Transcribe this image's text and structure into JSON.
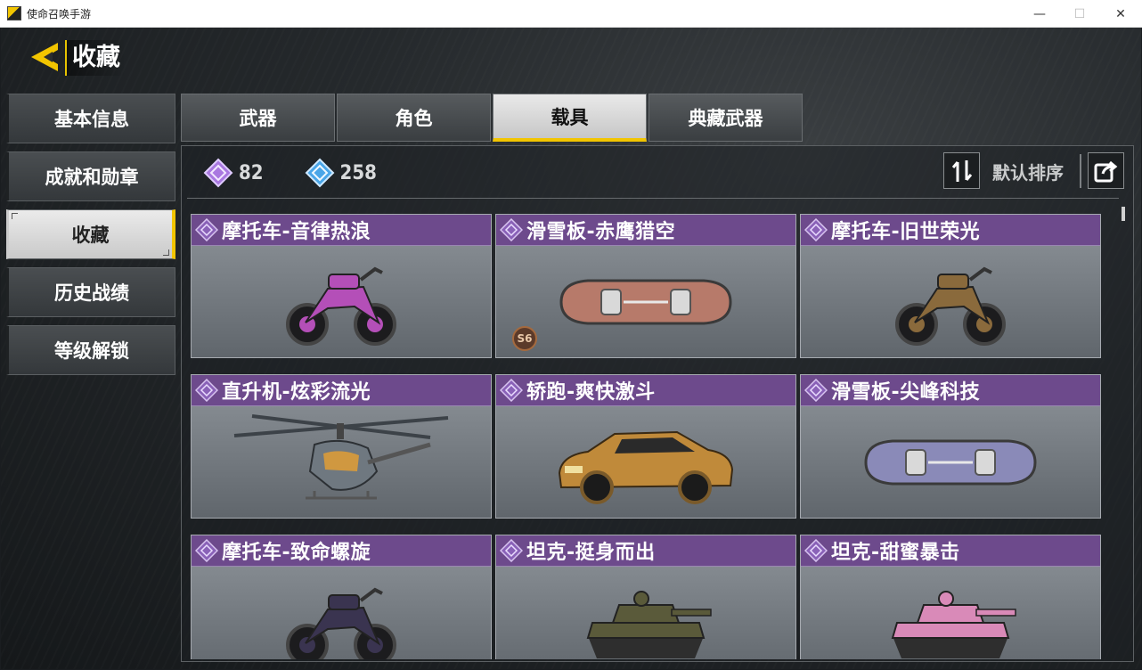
{
  "window": {
    "title": "使命召唤手游",
    "controls": {
      "minimize": "—",
      "maximize": "☐",
      "close": "✕"
    }
  },
  "header": {
    "title": "收藏",
    "back_icon": "back-arrow-icon",
    "accent_color": "#f2c500"
  },
  "side_menu": {
    "items": [
      {
        "label": "基本信息",
        "active": false
      },
      {
        "label": "成就和勋章",
        "active": false
      },
      {
        "label": "收藏",
        "active": true
      },
      {
        "label": "历史战绩",
        "active": false
      },
      {
        "label": "等级解锁",
        "active": false
      }
    ]
  },
  "tabs": [
    {
      "label": "武器",
      "active": false
    },
    {
      "label": "角色",
      "active": false
    },
    {
      "label": "载具",
      "active": true
    },
    {
      "label": "典藏武器",
      "active": false
    }
  ],
  "stats": {
    "epic_count": "82",
    "rare_count": "258",
    "epic_color": "#a978e0",
    "rare_color": "#4aa6e8"
  },
  "sort": {
    "label": "默认排序",
    "icon": "sort-icon",
    "share_icon": "share-icon"
  },
  "vehicles": [
    {
      "name": "摩托车-音律热浪",
      "type": "motorcycle",
      "color": "#b44fb8"
    },
    {
      "name": "滑雪板-赤鹰猎空",
      "type": "snowboard",
      "color": "#b77a6a",
      "badge": "S6"
    },
    {
      "name": "摩托车-旧世荣光",
      "type": "motorcycle",
      "color": "#8a6a3c"
    },
    {
      "name": "直升机-炫彩流光",
      "type": "helicopter",
      "color": "#6f7880"
    },
    {
      "name": "轿跑-爽快激斗",
      "type": "car",
      "color": "#c08a3a"
    },
    {
      "name": "滑雪板-尖峰科技",
      "type": "snowboard",
      "color": "#8a8ab8"
    },
    {
      "name": "摩托车-致命螺旋",
      "type": "motorcycle",
      "color": "#3a3450"
    },
    {
      "name": "坦克-挺身而出",
      "type": "tank",
      "color": "#5a5a3a"
    },
    {
      "name": "坦克-甜蜜暴击",
      "type": "tank",
      "color": "#d98ab8"
    }
  ]
}
